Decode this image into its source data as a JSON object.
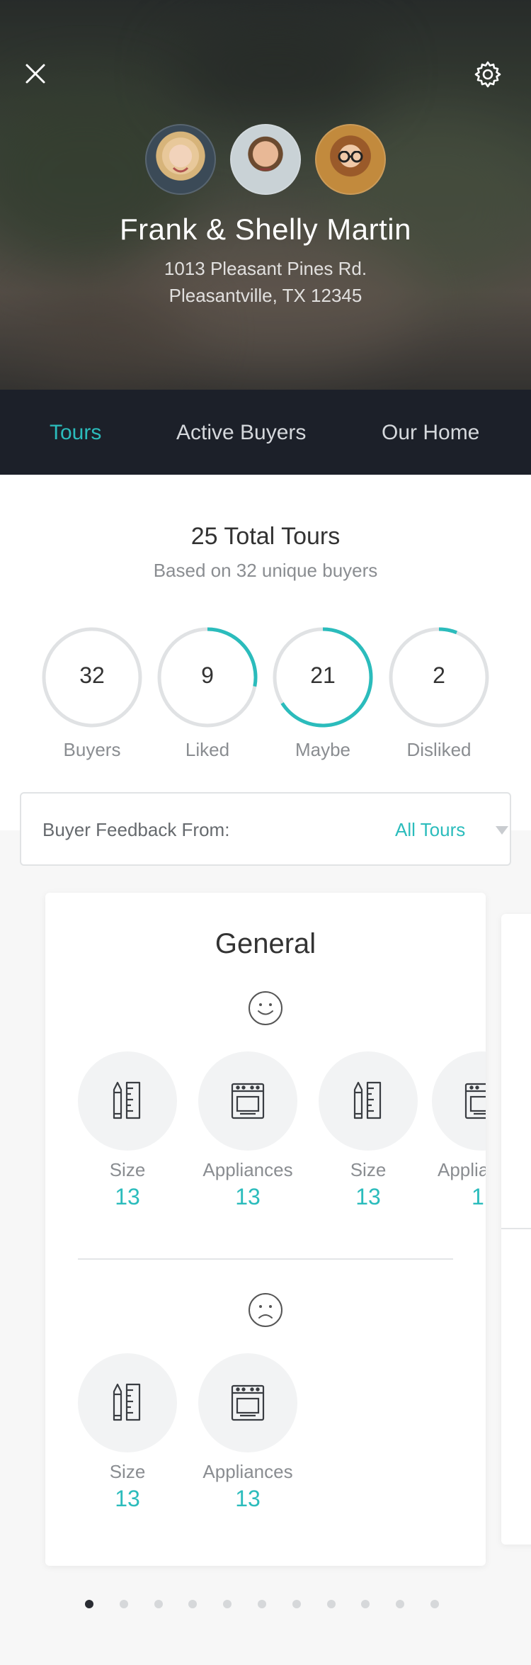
{
  "header": {
    "name": "Frank & Shelly Martin",
    "address_line1": "1013 Pleasant Pines Rd.",
    "address_line2": "Pleasantville, TX 12345",
    "close_icon": "close-icon",
    "settings_icon": "gear-icon"
  },
  "tabs": [
    {
      "label": "Tours",
      "active": true
    },
    {
      "label": "Active Buyers",
      "active": false
    },
    {
      "label": "Our Home",
      "active": false
    }
  ],
  "summary": {
    "title": "25 Total Tours",
    "subtitle": "Based on 32 unique buyers"
  },
  "stats": [
    {
      "value": "32",
      "label": "Buyers",
      "fraction": 0
    },
    {
      "value": "9",
      "label": "Liked",
      "fraction": 0.28
    },
    {
      "value": "21",
      "label": "Maybe",
      "fraction": 0.66
    },
    {
      "value": "2",
      "label": "Disliked",
      "fraction": 0.06
    }
  ],
  "filter": {
    "label": "Buyer Feedback From:",
    "value": "All Tours"
  },
  "card": {
    "title": "General",
    "positive_icon": "smile-icon",
    "negative_icon": "frown-icon",
    "positive_items": [
      {
        "label": "Size",
        "count": "13",
        "icon": "ruler-pencil-icon"
      },
      {
        "label": "Appliances",
        "count": "13",
        "icon": "oven-icon"
      },
      {
        "label": "Size",
        "count": "13",
        "icon": "ruler-pencil-icon"
      },
      {
        "label": "Applia",
        "count": "1",
        "icon": "oven-icon"
      }
    ],
    "negative_items": [
      {
        "label": "Size",
        "count": "13",
        "icon": "ruler-pencil-icon"
      },
      {
        "label": "Appliances",
        "count": "13",
        "icon": "oven-icon"
      }
    ]
  },
  "pager": {
    "total": 11,
    "active_index": 0
  },
  "colors": {
    "accent": "#2bbcbc",
    "tabbar": "#1c2029",
    "ring_track": "#e0e2e4"
  }
}
